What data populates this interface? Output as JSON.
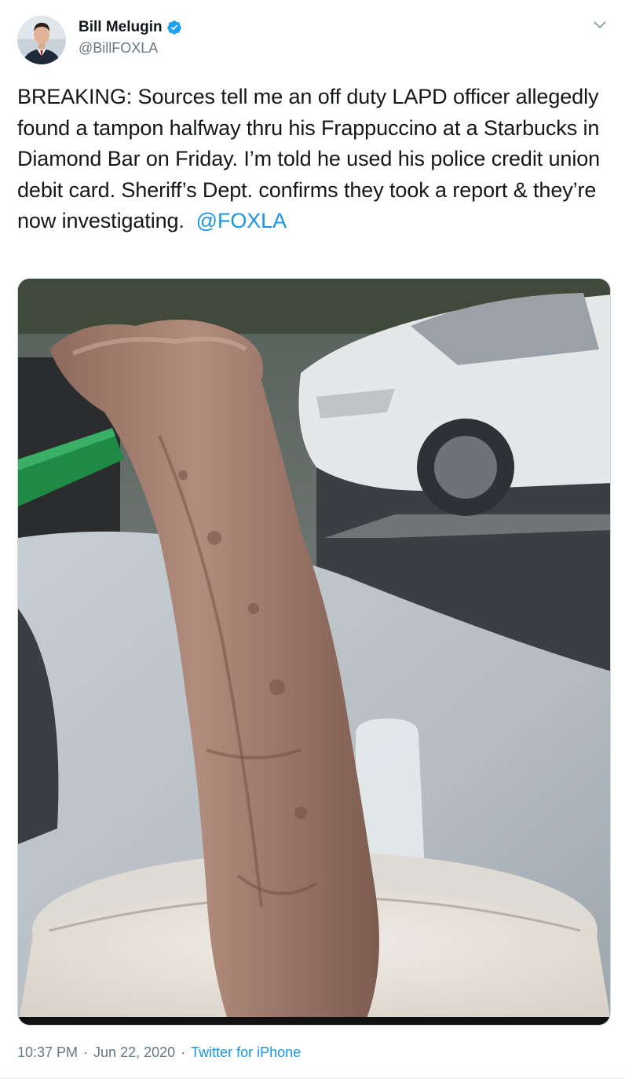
{
  "author": {
    "name": "Bill Melugin",
    "handle": "@BillFOXLA",
    "verified": true,
    "avatar_icon": "profile-photo"
  },
  "tweet": {
    "text": "BREAKING: Sources tell me an off duty LAPD officer allegedly found a tampon halfway thru his Frappuccino at a Starbucks in Diamond Bar on Friday. I’m told he used his police credit union debit card. Sheriff’s Dept. confirms they took a report & they’re now investigating.  ",
    "mention": "@FOXLA",
    "media_icon": "photo-tampon-in-frappuccino-cup"
  },
  "meta": {
    "time": "10:37 PM",
    "separator": "·",
    "date": "Jun 22, 2020",
    "source": "Twitter for iPhone"
  },
  "colors": {
    "link": "#1b95e0",
    "verified": "#1da1f2",
    "secondary_text": "#657786"
  }
}
